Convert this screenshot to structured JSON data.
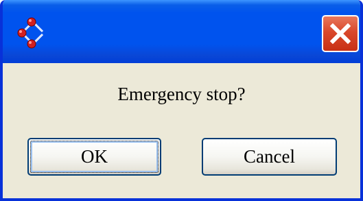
{
  "dialog": {
    "title": "",
    "message": "Emergency stop?",
    "ok_label": "OK",
    "cancel_label": "Cancel"
  },
  "titlebar": {
    "icon": "app-icon",
    "close_icon": "close-icon"
  },
  "colors": {
    "titlebar": "#0053ee",
    "frame": "#0831d9",
    "client_bg": "#ece9d8",
    "close_button": "#d9482b",
    "button_border": "#003c74"
  }
}
